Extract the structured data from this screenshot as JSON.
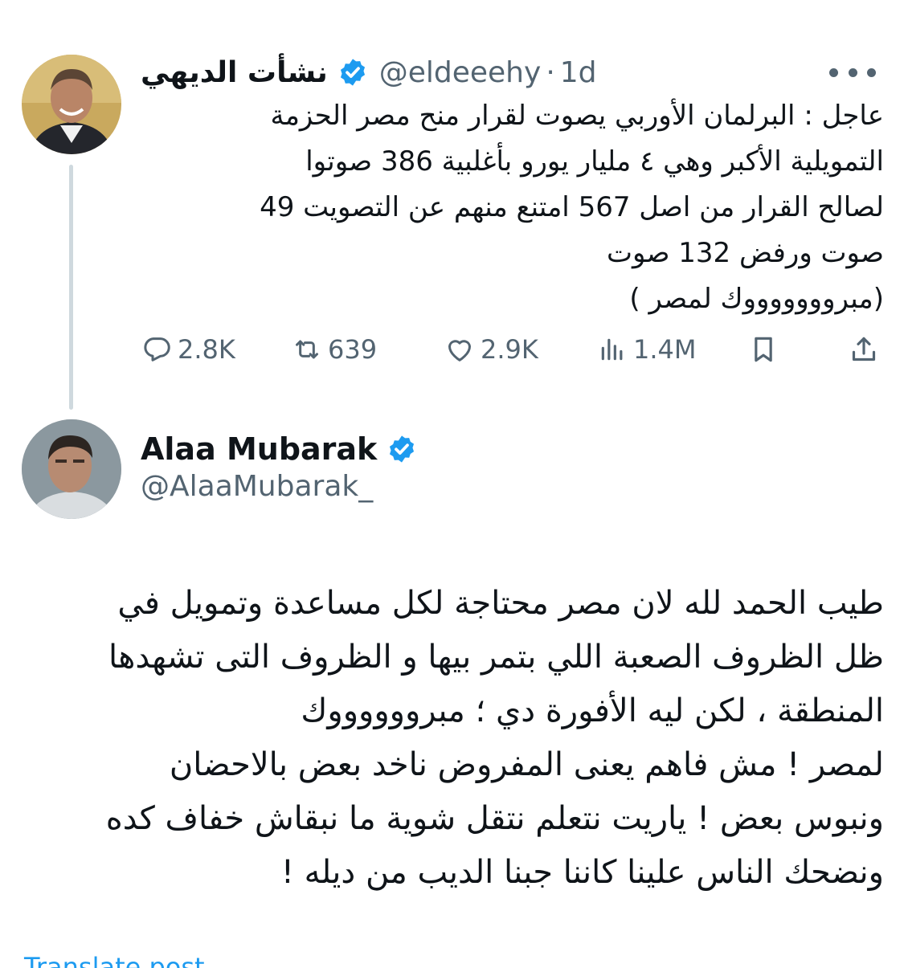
{
  "thread": {
    "original_tweet": {
      "author_name": "نشأت الديهي",
      "handle": "@eldeeehy",
      "separator": "·",
      "time": "1d",
      "text_lines": [
        "عاجل : البرلمان الأوربي يصوت لقرار منح مصر الحزمة",
        "التمويلية الأكبر وهي ٤ مليار يورو بأغلبية 386 صوتوا",
        "لصالح القرار من اصل 567 امتنع منهم عن التصويت 49",
        "صوت ورفض 132 صوت",
        "(مبروووووووك لمصر )"
      ],
      "metrics": {
        "replies": "2.8K",
        "reposts": "639",
        "likes": "2.9K",
        "views": "1.4M"
      }
    },
    "reply_tweet": {
      "author_name": "Alaa Mubarak",
      "handle": "@AlaaMubarak_",
      "text_lines": [
        "طيب الحمد لله لان مصر محتاجة لكل مساعدة وتمويل في",
        "ظل الظروف الصعبة اللي بتمر بيها و الظروف التى تشهدها",
        "المنطقة ، لكن ليه الأفورة دي ؛ مبرووووووك",
        "لمصر ! مش فاهم يعنى المفروض ناخد بعض بالاحضان",
        "ونبوس بعض ! ياريت نتعلم نتقل شوية ما نبقاش خفاف كده",
        "ونضحك الناس علينا كاننا جبنا الديب من ديله !"
      ],
      "translate_label": "Translate post"
    }
  },
  "icons": {
    "verified": "verified-badge-icon",
    "more": "more-dots-icon",
    "reply": "reply-bubble-icon",
    "repost": "repost-arrows-icon",
    "like": "heart-icon",
    "views": "views-bars-icon",
    "bookmark": "bookmark-icon",
    "share": "share-upload-icon"
  },
  "colors": {
    "verified_blue": "#1d9bf0",
    "text_primary": "#0f1419",
    "text_secondary": "#536471",
    "thread_line": "#cfd9de",
    "link": "#1d9bf0"
  }
}
